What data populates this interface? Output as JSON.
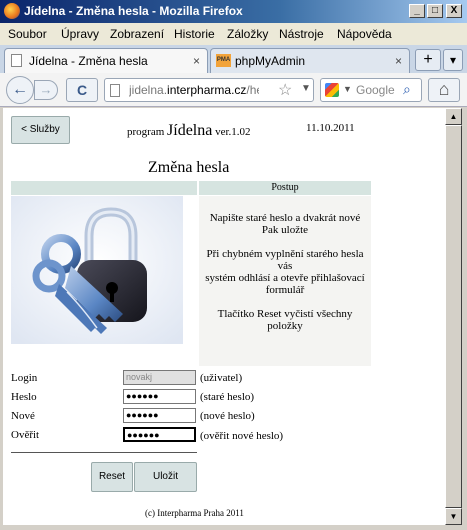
{
  "window": {
    "title": "Jídelna - Změna hesla - Mozilla Firefox",
    "controls": {
      "minimize": "_",
      "maximize": "□",
      "close": "X"
    }
  },
  "menu": [
    "Soubor",
    "Úpravy",
    "Zobrazení",
    "Historie",
    "Záložky",
    "Nástroje",
    "Nápověda"
  ],
  "tabs": [
    {
      "label": "Jídelna - Změna hesla",
      "close": "×"
    },
    {
      "label": "phpMyAdmin",
      "close": "×",
      "icon_text": "PMA"
    }
  ],
  "newtab": "+",
  "tab_list": "▾",
  "nav": {
    "back": "←",
    "forward": "→",
    "reload": "C",
    "url_prefix": "jidelna.",
    "url_domain": "interpharma.cz",
    "url_suffix": "/heslo",
    "bookmark_star": "☆",
    "url_dropdown": "▼",
    "search_placeholder": "Google",
    "search_dropdown": "▼",
    "search_button": "⌕",
    "home": "⌂"
  },
  "page": {
    "back_button": "< Služby",
    "program_prefix": "program",
    "program_name": "Jídelna",
    "program_version": "ver.1.02",
    "date": "11.10.2011",
    "heading": "Změna hesla",
    "postup_header": "Postup",
    "postup_lines": [
      "Napište staré heslo a dvakrát nové",
      "Pak uložte",
      "",
      "Při chybném vyplnění starého hesla",
      "vás",
      "systém odhlásí a otevře přihlašovací",
      "formulář",
      "",
      "Tlačítko Reset vyčistí všechny",
      "položky"
    ],
    "form": [
      {
        "label": "Login",
        "value": "novakj",
        "hint": "(uživatel)"
      },
      {
        "label": "Heslo",
        "value": "●●●●●●",
        "hint": "(staré heslo)"
      },
      {
        "label": "Nové",
        "value": "●●●●●●",
        "hint": "(nové heslo)"
      },
      {
        "label": "Ověřit",
        "value": "●●●●●●",
        "hint": "(ověřit nové heslo)"
      }
    ],
    "reset_button": "Reset",
    "save_button": "Uložit",
    "footer": "(c) Interpharma Praha 2011"
  },
  "colors": {
    "table_header_bg": "#d6e4e0",
    "button_bg": "#d8e3e3",
    "lock_body": "#2a2a35",
    "key_blue": "#5a86c4"
  }
}
